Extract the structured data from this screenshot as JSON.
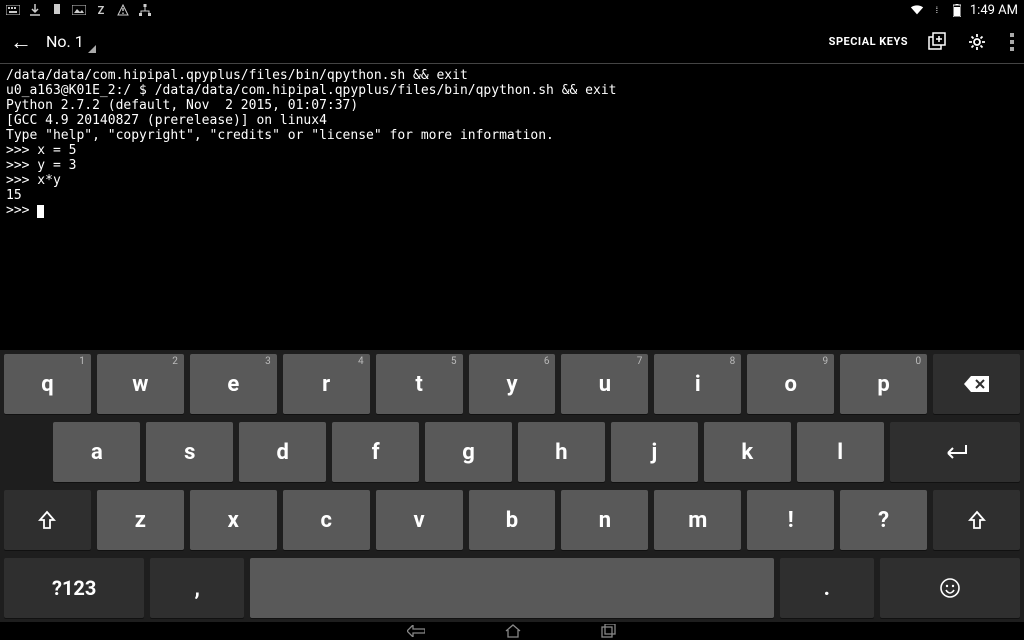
{
  "statusbar": {
    "time": "1:49 AM",
    "icons_left": [
      "keyboard",
      "download",
      "notification",
      "image",
      "Z",
      "warning",
      "network"
    ],
    "icons_right": [
      "wifi",
      "signal",
      "battery"
    ]
  },
  "appbar": {
    "title": "No. 1",
    "special_keys_label": "SPECIAL KEYS"
  },
  "terminal": {
    "lines": [
      "/data/data/com.hipipal.qpyplus/files/bin/qpython.sh && exit",
      "u0_a163@K01E_2:/ $ /data/data/com.hipipal.qpyplus/files/bin/qpython.sh && exit",
      "Python 2.7.2 (default, Nov  2 2015, 01:07:37)",
      "[GCC 4.9 20140827 (prerelease)] on linux4",
      "Type \"help\", \"copyright\", \"credits\" or \"license\" for more information.",
      ">>> x = 5",
      ">>> y = 3",
      ">>> x*y",
      "15",
      ">>> "
    ]
  },
  "keyboard": {
    "row1": [
      {
        "l": "q",
        "h": "1"
      },
      {
        "l": "w",
        "h": "2"
      },
      {
        "l": "e",
        "h": "3"
      },
      {
        "l": "r",
        "h": "4"
      },
      {
        "l": "t",
        "h": "5"
      },
      {
        "l": "y",
        "h": "6"
      },
      {
        "l": "u",
        "h": "7"
      },
      {
        "l": "i",
        "h": "8"
      },
      {
        "l": "o",
        "h": "9"
      },
      {
        "l": "p",
        "h": "0"
      }
    ],
    "row2": [
      "a",
      "s",
      "d",
      "f",
      "g",
      "h",
      "j",
      "k",
      "l"
    ],
    "row3": [
      "z",
      "x",
      "c",
      "v",
      "b",
      "n",
      "m",
      "!",
      "?"
    ],
    "row4": {
      "sym": "?123",
      "comma": ",",
      "period": "."
    }
  }
}
